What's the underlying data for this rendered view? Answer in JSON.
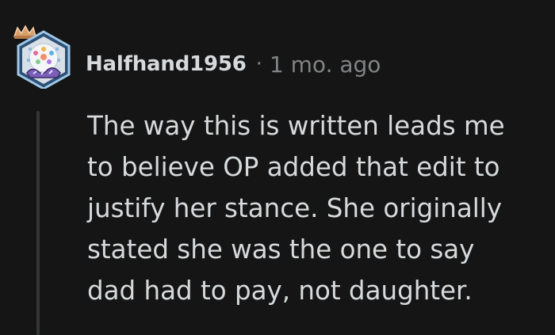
{
  "comment": {
    "author": "Halfhand1956",
    "separator": "·",
    "timestamp": "1 mo. ago",
    "body_lines": [
      "The way this is written leads me",
      "to believe OP added that edit to",
      "justify her stance. She originally",
      "stated she was the one to say",
      "dad had to pay, not daughter."
    ]
  },
  "avatar": {
    "icon": "hexagon-avatar-with-crown-icon",
    "frame_color": "#3f6f9e",
    "crown_color": "#d9a06a"
  },
  "colors": {
    "background": "#151515",
    "text": "#d7dadc",
    "meta": "#818384",
    "thread_line": "#343536"
  }
}
